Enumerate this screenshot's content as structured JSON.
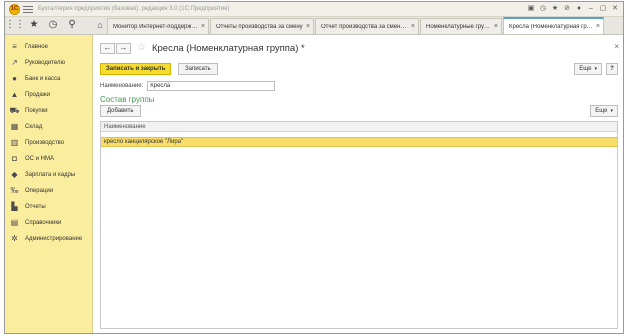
{
  "app": {
    "logo_text": "1С",
    "title": "Бухгалтерия предприятия (базовая), редакция 3.0 (1С:Предприятие)"
  },
  "titlebar_icons": [
    "message-icon",
    "history-icon",
    "star-icon",
    "link-icon",
    "bell-icon",
    "minimize-icon",
    "maximize-icon",
    "close-icon"
  ],
  "titlebar_glyphs": [
    "▣",
    "◷",
    "★",
    "⊘",
    "♦",
    "–",
    "▢",
    "✕"
  ],
  "tabrow_icons": [
    "apps-icon",
    "favorites-icon",
    "history-icon",
    "search-icon"
  ],
  "tabrow_glyphs": [
    "⋮⋮",
    "★",
    "◷",
    "⚲"
  ],
  "home_glyph": "⌂",
  "tabs": [
    {
      "label": "Монитор Интернет-поддержки ...",
      "close": "×"
    },
    {
      "label": "Отчеты производства за смену",
      "close": "×"
    },
    {
      "label": "Отчет производства за смену (...",
      "close": "×"
    },
    {
      "label": "Номенклатурные группы",
      "close": "×"
    },
    {
      "label": "Кресла (Номенклатурная гру...",
      "close": "×",
      "active": true
    }
  ],
  "sidebar": {
    "items": [
      {
        "label": "Главное",
        "icon": "menu-icon",
        "glyph": "≡"
      },
      {
        "label": "Руководителю",
        "icon": "trend-icon",
        "glyph": "↗"
      },
      {
        "label": "Банк и касса",
        "icon": "coin-icon",
        "glyph": "●"
      },
      {
        "label": "Продажи",
        "icon": "bag-icon",
        "glyph": "▲"
      },
      {
        "label": "Покупки",
        "icon": "cart-icon",
        "glyph": "⛟"
      },
      {
        "label": "Склад",
        "icon": "warehouse-icon",
        "glyph": "▦"
      },
      {
        "label": "Производство",
        "icon": "factory-icon",
        "glyph": "▥"
      },
      {
        "label": "ОС и НМА",
        "icon": "truck-icon",
        "glyph": "◘"
      },
      {
        "label": "Зарплата и кадры",
        "icon": "people-icon",
        "glyph": "◆"
      },
      {
        "label": "Операции",
        "icon": "operations-icon",
        "glyph": "‰"
      },
      {
        "label": "Отчеты",
        "icon": "report-icon",
        "glyph": "▙"
      },
      {
        "label": "Справочники",
        "icon": "book-icon",
        "glyph": "▤"
      },
      {
        "label": "Администрирование",
        "icon": "gear-icon",
        "glyph": "✲"
      }
    ]
  },
  "form": {
    "back_glyph": "←",
    "forward_glyph": "→",
    "star_glyph": "☆",
    "title": "Кресла (Номенклатурная группа) *",
    "close_glyph": "×",
    "save_close_label": "Записать и закрыть",
    "save_label": "Записать",
    "more_label": "Еще",
    "caret": "▾",
    "help_label": "?",
    "name_label": "Наименование:",
    "name_value": "Кресла",
    "group_title": "Состав группы",
    "add_label": "Добавить",
    "table_more_label": "Еще",
    "table_header": "Наименование",
    "rows": [
      {
        "name": "кресло канцелярское \"Лира\""
      }
    ]
  }
}
